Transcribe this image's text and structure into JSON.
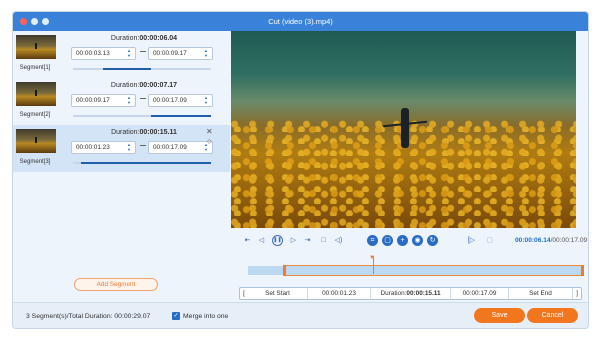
{
  "window": {
    "title": "Cut (video (3).mp4)"
  },
  "segments": [
    {
      "name": "Segment[1]",
      "duration_label": "Duration:",
      "duration": "00:00:06.04",
      "start": "00:00:03.13",
      "end": "00:00:09.17",
      "selected": false
    },
    {
      "name": "Segment[2]",
      "duration_label": "Duration:",
      "duration": "00:00:07.17",
      "start": "00:00:09.17",
      "end": "00:00:17.09",
      "selected": false
    },
    {
      "name": "Segment[3]",
      "duration_label": "Duration:",
      "duration": "00:00:15.11",
      "start": "00:00:01.23",
      "end": "00:00:17.09",
      "selected": true
    }
  ],
  "add_segment_label": "Add Segment",
  "player": {
    "current_time": "00:00:06.14",
    "total_time": "/00:00:17.09"
  },
  "range": {
    "set_start_label": "Set Start",
    "start": "00:00:01.23",
    "duration_label": "Duration:",
    "duration": "00:00:15.11",
    "end": "00:00:17.09",
    "set_end_label": "Set End"
  },
  "footer": {
    "total_text": "3 Segment(s)/Total Duration: 00:00:29.07",
    "merge_label": "Merge into one",
    "merge_checked": true,
    "save_label": "Save",
    "cancel_label": "Cancel"
  },
  "colors": {
    "accent_blue": "#3a82d9",
    "accent_orange": "#f2761d",
    "panel_bg": "#eef4fc"
  },
  "icons": [
    "close-icon",
    "minimize-icon",
    "maximize-icon",
    "delete-segment-icon",
    "move-up-icon",
    "skip-start-icon",
    "step-back-icon",
    "pause-icon",
    "step-forward-icon",
    "skip-end-icon",
    "stop-icon",
    "volume-icon",
    "split-icon",
    "copy-icon",
    "add-icon",
    "zoom-icon",
    "rotate-icon",
    "mark-in-icon",
    "mark-out-icon"
  ]
}
